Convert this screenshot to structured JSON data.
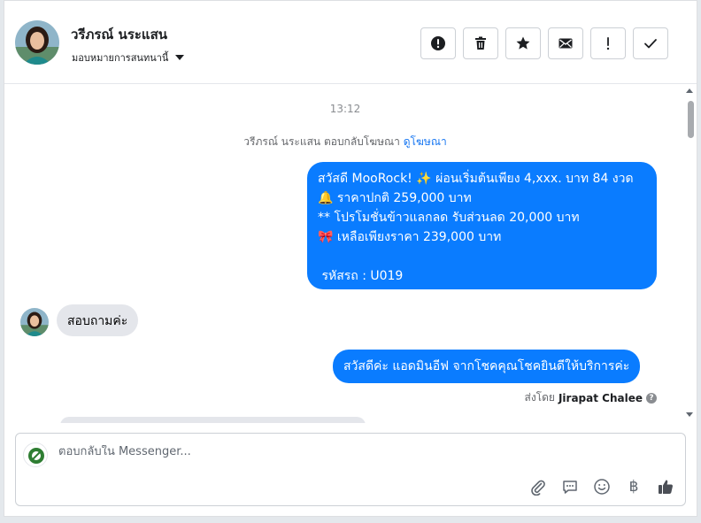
{
  "header": {
    "contact_name": "วรีภรณ์ นระแสน",
    "assign_label": "มอบหมายการสนทนานี้"
  },
  "actions": {
    "icons": [
      "alert-circle-icon",
      "trash-icon",
      "star-icon",
      "envelope-icon",
      "exclamation-icon",
      "check-icon"
    ]
  },
  "chat": {
    "timestamp": "13:12",
    "reply_note_prefix": "วรีภรณ์ นระแสน ตอบกลับโฆษณา",
    "reply_note_link": "ดูโฆษณา",
    "promo_lines": [
      "สวัสดี MooRock! ✨ ผ่อนเริ่มต้นเพียง 4,xxx. บาท 84 งวด",
      "🔔 ราคาปกติ 259,000 บาท",
      "** โปรโมชั่นข้าวแลกลด รับส่วนลด 20,000 บาท",
      "🎀 เหลือเพียงราคา 239,000 บาท",
      "",
      " รหัสรถ : U019"
    ],
    "incoming_message": "สอบถามค่ะ",
    "outgoing_message": "สวัสดีค่ะ แอดมินอีฟ จากโชคคุณโชคยินดีให้บริการค่ะ",
    "sent_by_label": "ส่งโดย",
    "sent_by_name": "Jirapat Chalee"
  },
  "composer": {
    "placeholder": "ตอบกลับใน Messenger...",
    "tools": [
      "paperclip-icon",
      "chat-bubble-icon",
      "smiley-icon",
      "baht-icon",
      "thumbs-up-icon"
    ],
    "baht_symbol": "฿"
  },
  "colors": {
    "outgoing_bubble": "#0a7cff",
    "incoming_bubble": "#e4e6eb",
    "link": "#1877f2"
  }
}
